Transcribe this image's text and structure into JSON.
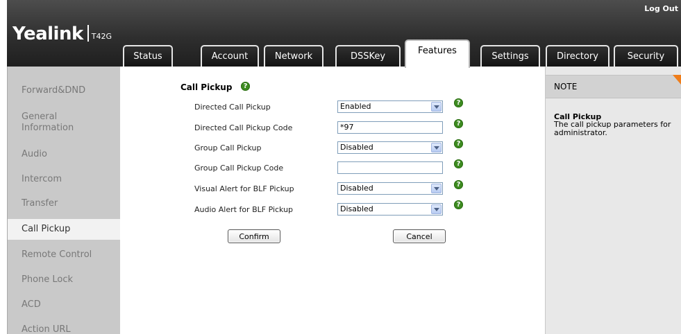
{
  "header": {
    "logo_name": "Yealink",
    "logo_model": "T42G",
    "logout_label": "Log Out"
  },
  "tabs": [
    {
      "label": "Status"
    },
    {
      "label": "Account"
    },
    {
      "label": "Network"
    },
    {
      "label": "DSSKey"
    },
    {
      "label": "Features",
      "active": true
    },
    {
      "label": "Settings"
    },
    {
      "label": "Directory"
    },
    {
      "label": "Security"
    }
  ],
  "sidebar": {
    "items": [
      {
        "label": "Forward&DND"
      },
      {
        "label": "General Information"
      },
      {
        "label": "Audio"
      },
      {
        "label": "Intercom"
      },
      {
        "label": "Transfer"
      },
      {
        "label": "Call Pickup",
        "active": true
      },
      {
        "label": "Remote Control"
      },
      {
        "label": "Phone Lock"
      },
      {
        "label": "ACD"
      },
      {
        "label": "Action URL"
      }
    ]
  },
  "main": {
    "section_title": "Call Pickup",
    "help_glyph": "?",
    "rows": [
      {
        "label": "Directed Call Pickup",
        "type": "select",
        "value": "Enabled"
      },
      {
        "label": "Directed Call Pickup Code",
        "type": "text",
        "value": "*97"
      },
      {
        "label": "Group Call Pickup",
        "type": "select",
        "value": "Disabled"
      },
      {
        "label": "Group Call Pickup Code",
        "type": "text",
        "value": ""
      },
      {
        "label": "Visual Alert for BLF Pickup",
        "type": "select",
        "value": "Disabled"
      },
      {
        "label": "Audio Alert for BLF Pickup",
        "type": "select",
        "value": "Disabled"
      }
    ],
    "confirm_label": "Confirm",
    "cancel_label": "Cancel"
  },
  "note": {
    "header": "NOTE",
    "title": "Call Pickup",
    "text": "The call pickup parameters for administrator."
  },
  "colors": {
    "help_icon": "#3d8b20",
    "note_corner": "#ef7d1a",
    "sidebar_bg": "#c9c9c9",
    "header_bg": "#2e2e2e"
  }
}
